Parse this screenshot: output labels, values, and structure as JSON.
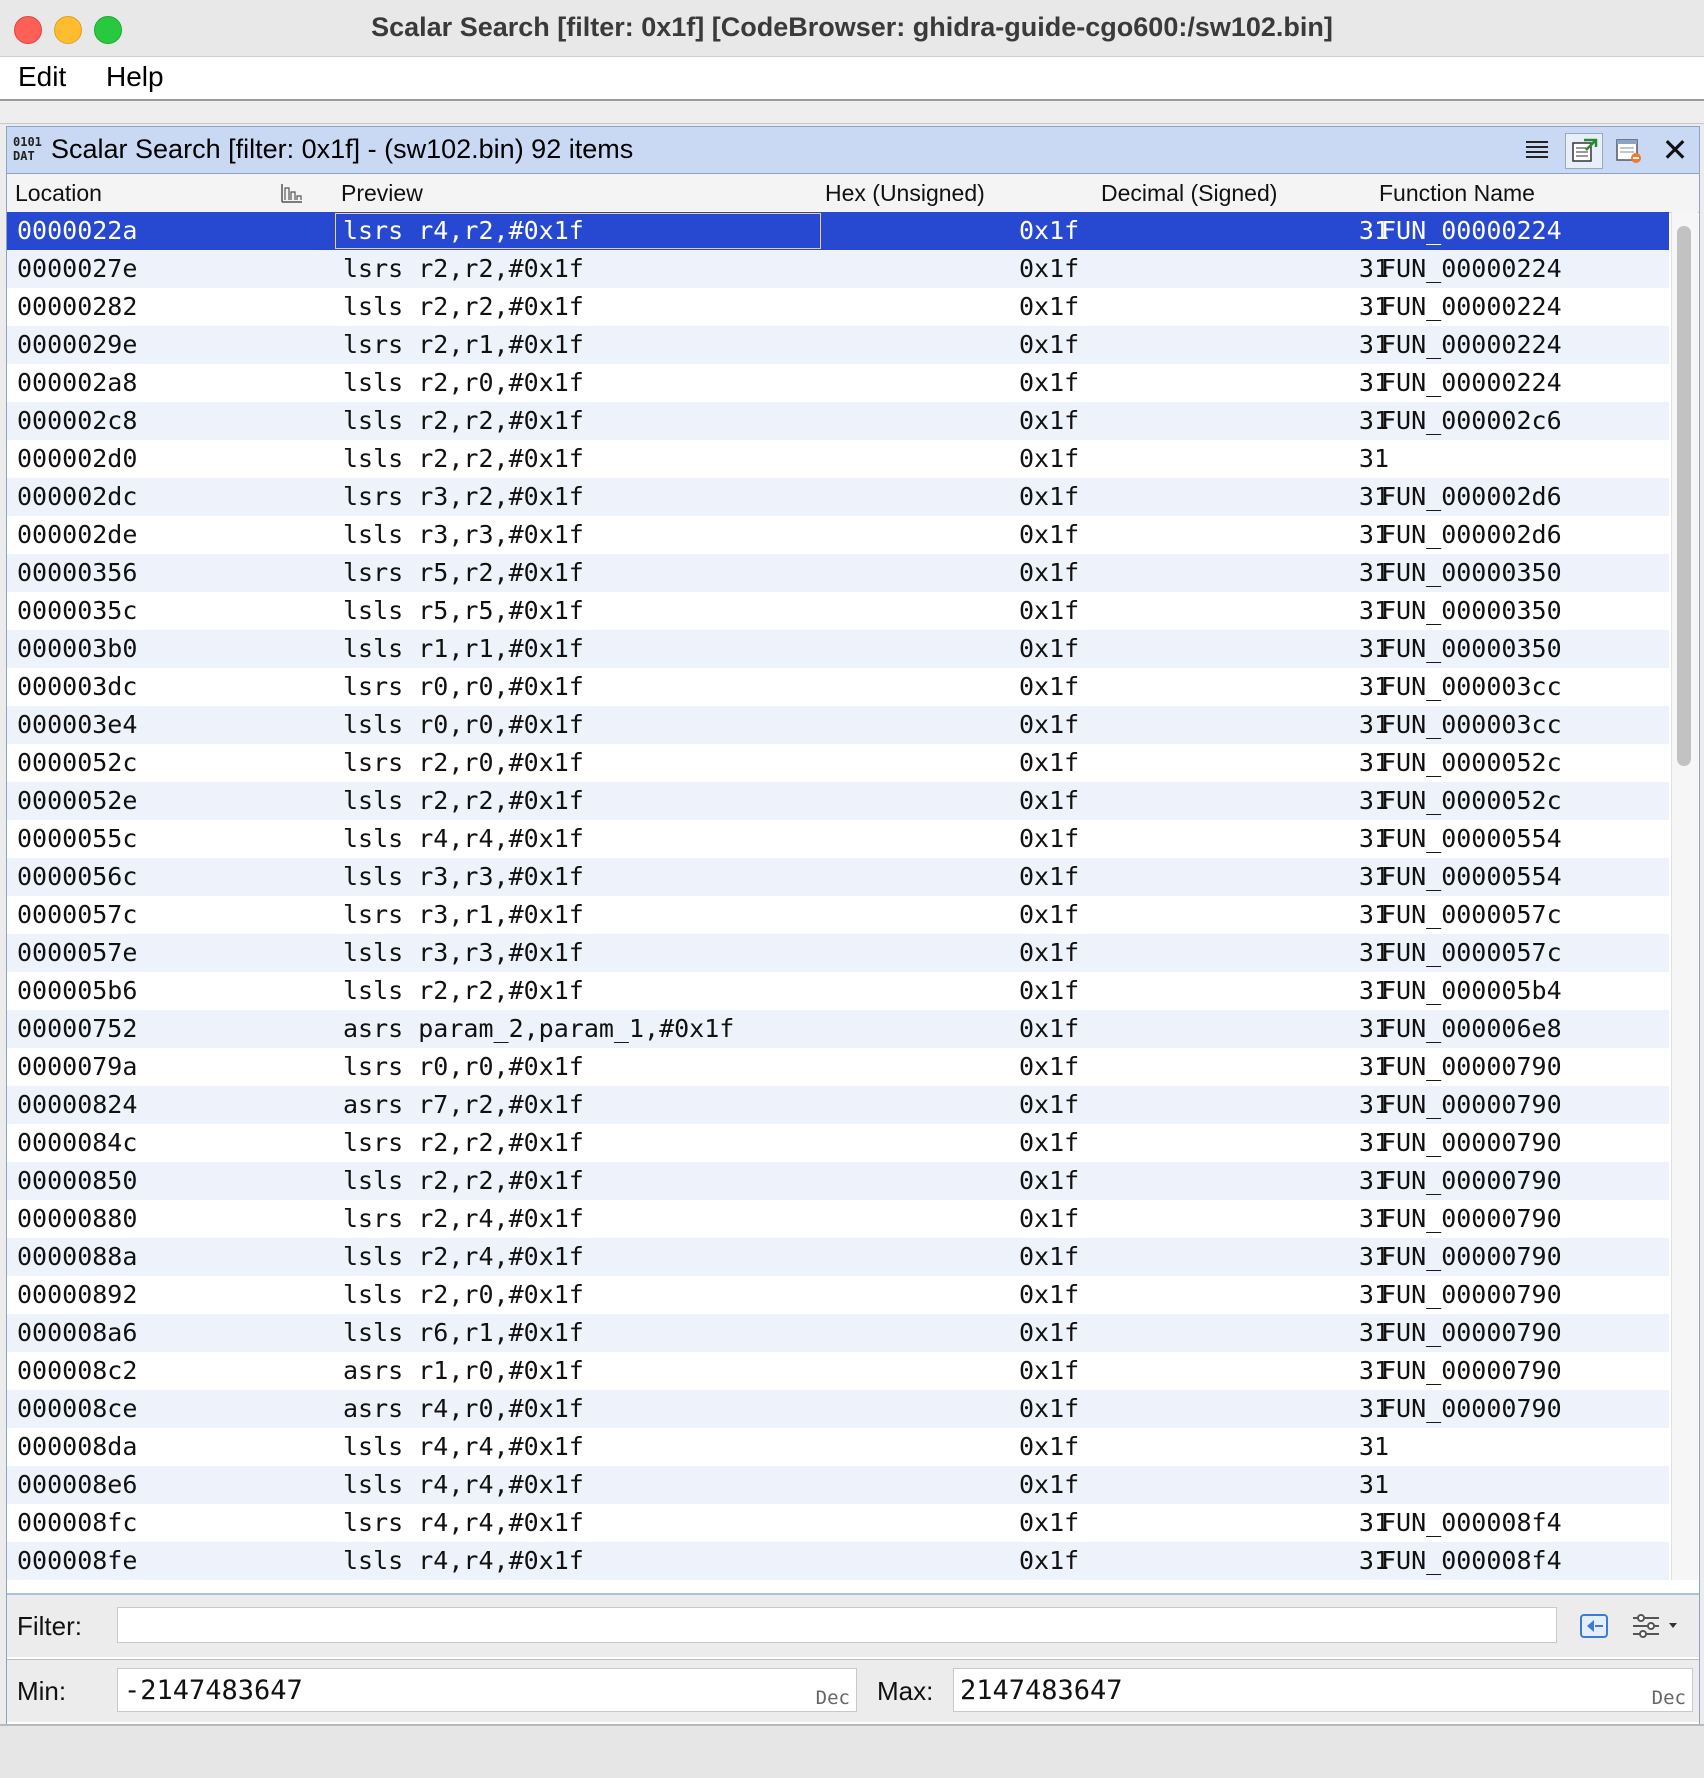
{
  "window": {
    "title": "Scalar Search [filter: 0x1f] [CodeBrowser: ghidra-guide-cgo600:/sw102.bin]"
  },
  "menu": {
    "edit": "Edit",
    "help": "Help"
  },
  "panel": {
    "icon_text_top": "0101",
    "icon_text_bottom": "DAT",
    "title": "Scalar Search [filter: 0x1f] -  (sw102.bin) 92 items",
    "buttons": [
      "list-view-icon",
      "go-to-selection-icon",
      "delete-table-icon",
      "close-icon"
    ],
    "close_glyph": "✕"
  },
  "table": {
    "columns": {
      "location": "Location",
      "preview": "Preview",
      "hex": "Hex (Unsigned)",
      "decimal": "Decimal (Signed)",
      "function": "Function Name"
    },
    "selected_index": 0,
    "rows": [
      {
        "loc": "0000022a",
        "preview": "lsrs r4,r2,#0x1f",
        "hex": "0x1f",
        "dec": "31",
        "fn": "FUN_00000224"
      },
      {
        "loc": "0000027e",
        "preview": "lsrs r2,r2,#0x1f",
        "hex": "0x1f",
        "dec": "31",
        "fn": "FUN_00000224"
      },
      {
        "loc": "00000282",
        "preview": "lsls r2,r2,#0x1f",
        "hex": "0x1f",
        "dec": "31",
        "fn": "FUN_00000224"
      },
      {
        "loc": "0000029e",
        "preview": "lsrs r2,r1,#0x1f",
        "hex": "0x1f",
        "dec": "31",
        "fn": "FUN_00000224"
      },
      {
        "loc": "000002a8",
        "preview": "lsls r2,r0,#0x1f",
        "hex": "0x1f",
        "dec": "31",
        "fn": "FUN_00000224"
      },
      {
        "loc": "000002c8",
        "preview": "lsls r2,r2,#0x1f",
        "hex": "0x1f",
        "dec": "31",
        "fn": "FUN_000002c6"
      },
      {
        "loc": "000002d0",
        "preview": "lsls r2,r2,#0x1f",
        "hex": "0x1f",
        "dec": "31",
        "fn": ""
      },
      {
        "loc": "000002dc",
        "preview": "lsrs r3,r2,#0x1f",
        "hex": "0x1f",
        "dec": "31",
        "fn": "FUN_000002d6"
      },
      {
        "loc": "000002de",
        "preview": "lsls r3,r3,#0x1f",
        "hex": "0x1f",
        "dec": "31",
        "fn": "FUN_000002d6"
      },
      {
        "loc": "00000356",
        "preview": "lsrs r5,r2,#0x1f",
        "hex": "0x1f",
        "dec": "31",
        "fn": "FUN_00000350"
      },
      {
        "loc": "0000035c",
        "preview": "lsls r5,r5,#0x1f",
        "hex": "0x1f",
        "dec": "31",
        "fn": "FUN_00000350"
      },
      {
        "loc": "000003b0",
        "preview": "lsls r1,r1,#0x1f",
        "hex": "0x1f",
        "dec": "31",
        "fn": "FUN_00000350"
      },
      {
        "loc": "000003dc",
        "preview": "lsrs r0,r0,#0x1f",
        "hex": "0x1f",
        "dec": "31",
        "fn": "FUN_000003cc"
      },
      {
        "loc": "000003e4",
        "preview": "lsls r0,r0,#0x1f",
        "hex": "0x1f",
        "dec": "31",
        "fn": "FUN_000003cc"
      },
      {
        "loc": "0000052c",
        "preview": "lsrs r2,r0,#0x1f",
        "hex": "0x1f",
        "dec": "31",
        "fn": "FUN_0000052c"
      },
      {
        "loc": "0000052e",
        "preview": "lsls r2,r2,#0x1f",
        "hex": "0x1f",
        "dec": "31",
        "fn": "FUN_0000052c"
      },
      {
        "loc": "0000055c",
        "preview": "lsls r4,r4,#0x1f",
        "hex": "0x1f",
        "dec": "31",
        "fn": "FUN_00000554"
      },
      {
        "loc": "0000056c",
        "preview": "lsls r3,r3,#0x1f",
        "hex": "0x1f",
        "dec": "31",
        "fn": "FUN_00000554"
      },
      {
        "loc": "0000057c",
        "preview": "lsrs r3,r1,#0x1f",
        "hex": "0x1f",
        "dec": "31",
        "fn": "FUN_0000057c"
      },
      {
        "loc": "0000057e",
        "preview": "lsls r3,r3,#0x1f",
        "hex": "0x1f",
        "dec": "31",
        "fn": "FUN_0000057c"
      },
      {
        "loc": "000005b6",
        "preview": "lsls r2,r2,#0x1f",
        "hex": "0x1f",
        "dec": "31",
        "fn": "FUN_000005b4"
      },
      {
        "loc": "00000752",
        "preview": "asrs param_2,param_1,#0x1f",
        "hex": "0x1f",
        "dec": "31",
        "fn": "FUN_000006e8"
      },
      {
        "loc": "0000079a",
        "preview": "lsrs r0,r0,#0x1f",
        "hex": "0x1f",
        "dec": "31",
        "fn": "FUN_00000790"
      },
      {
        "loc": "00000824",
        "preview": "asrs r7,r2,#0x1f",
        "hex": "0x1f",
        "dec": "31",
        "fn": "FUN_00000790"
      },
      {
        "loc": "0000084c",
        "preview": "lsrs r2,r2,#0x1f",
        "hex": "0x1f",
        "dec": "31",
        "fn": "FUN_00000790"
      },
      {
        "loc": "00000850",
        "preview": "lsls r2,r2,#0x1f",
        "hex": "0x1f",
        "dec": "31",
        "fn": "FUN_00000790"
      },
      {
        "loc": "00000880",
        "preview": "lsrs r2,r4,#0x1f",
        "hex": "0x1f",
        "dec": "31",
        "fn": "FUN_00000790"
      },
      {
        "loc": "0000088a",
        "preview": "lsls r2,r4,#0x1f",
        "hex": "0x1f",
        "dec": "31",
        "fn": "FUN_00000790"
      },
      {
        "loc": "00000892",
        "preview": "lsls r2,r0,#0x1f",
        "hex": "0x1f",
        "dec": "31",
        "fn": "FUN_00000790"
      },
      {
        "loc": "000008a6",
        "preview": "lsls r6,r1,#0x1f",
        "hex": "0x1f",
        "dec": "31",
        "fn": "FUN_00000790"
      },
      {
        "loc": "000008c2",
        "preview": "asrs r1,r0,#0x1f",
        "hex": "0x1f",
        "dec": "31",
        "fn": "FUN_00000790"
      },
      {
        "loc": "000008ce",
        "preview": "asrs r4,r0,#0x1f",
        "hex": "0x1f",
        "dec": "31",
        "fn": "FUN_00000790"
      },
      {
        "loc": "000008da",
        "preview": "lsls r4,r4,#0x1f",
        "hex": "0x1f",
        "dec": "31",
        "fn": ""
      },
      {
        "loc": "000008e6",
        "preview": "lsls r4,r4,#0x1f",
        "hex": "0x1f",
        "dec": "31",
        "fn": ""
      },
      {
        "loc": "000008fc",
        "preview": "lsrs r4,r4,#0x1f",
        "hex": "0x1f",
        "dec": "31",
        "fn": "FUN_000008f4"
      },
      {
        "loc": "000008fe",
        "preview": "lsls r4,r4,#0x1f",
        "hex": "0x1f",
        "dec": "31",
        "fn": "FUN_000008f4"
      }
    ]
  },
  "filter": {
    "label": "Filter:",
    "value": ""
  },
  "range": {
    "min_label": "Min:",
    "min_value": "-2147483647",
    "min_unit": "Dec",
    "max_label": "Max:",
    "max_value": "2147483647",
    "max_unit": "Dec"
  },
  "colors": {
    "selection": "#2748d0",
    "header_bg": "#c9d9f4",
    "alt_row": "#eef3fb"
  }
}
